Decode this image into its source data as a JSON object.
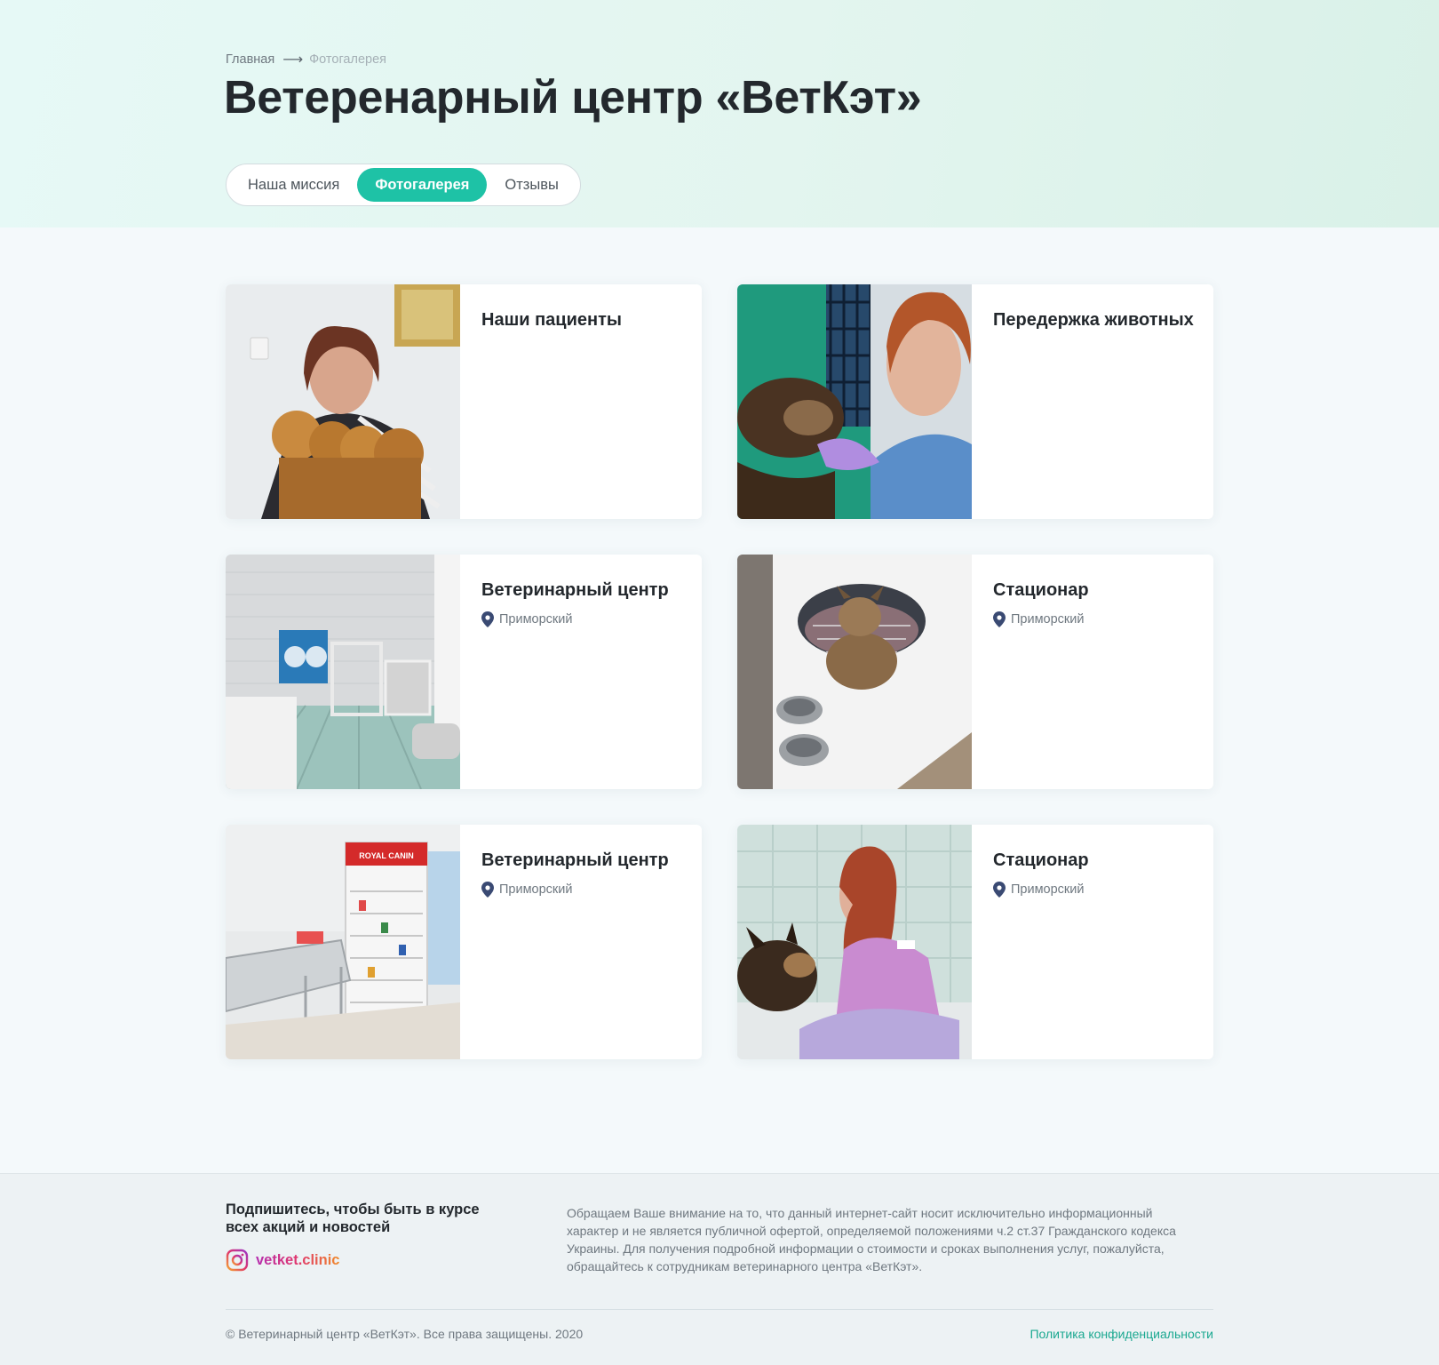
{
  "breadcrumb": {
    "home": "Главная",
    "current": "Фотогалерея"
  },
  "page_title": "Ветеренарный центр «ВетКэт»",
  "tabs": [
    {
      "label": "Наша миссия",
      "active": false
    },
    {
      "label": "Фотогалерея",
      "active": true
    },
    {
      "label": "Отзывы",
      "active": false
    }
  ],
  "gallery": [
    {
      "title": "Наши пациенты",
      "location": "",
      "photo": "woman-with-pomeranian-puppies"
    },
    {
      "title": "Передержка животных",
      "location": "",
      "photo": "nurse-with-puppy-in-cage"
    },
    {
      "title": "Ветеринарный центр",
      "location": "Приморский",
      "photo": "clinic-exam-room"
    },
    {
      "title": "Стационар",
      "location": "Приморский",
      "photo": "puppy-in-pet-bed"
    },
    {
      "title": "Ветеринарный центр",
      "location": "Приморский",
      "photo": "clinic-room-with-royal-canin-cabinet",
      "photo_text": "ROYAL CANIN"
    },
    {
      "title": "Стационар",
      "location": "Приморский",
      "photo": "vet-with-puppy-on-floor"
    }
  ],
  "footer": {
    "subscribe": "Подпишитесь, чтобы быть в курсе всех акций и новостей",
    "instagram": "vetket.clinic",
    "disclaimer": "Обращаем Ваше внимание на то, что данный интернет-сайт носит исключительно информационный характер и не является публичной офертой, определяемой положениями ч.2 ст.37 Гражданского кодекса Украины. Для получения подробной информации о стоимости и сроках выполнения услуг, пожалуйста, обращайтесь к сотрудникам ветеринарного центра «ВетКэт».",
    "copyright": "© Ветеринарный центр «ВетКэт». Все права защищены. 2020",
    "privacy": "Политика конфиденциальности"
  },
  "colors": {
    "accent": "#1ec2a6",
    "link": "#1aa890",
    "text": "#23282d",
    "muted": "#6f7880",
    "pin": "#3a4a73"
  },
  "icons": {
    "breadcrumb_arrow": "arrow-right-icon",
    "location": "map-pin-icon",
    "instagram": "instagram-icon"
  }
}
